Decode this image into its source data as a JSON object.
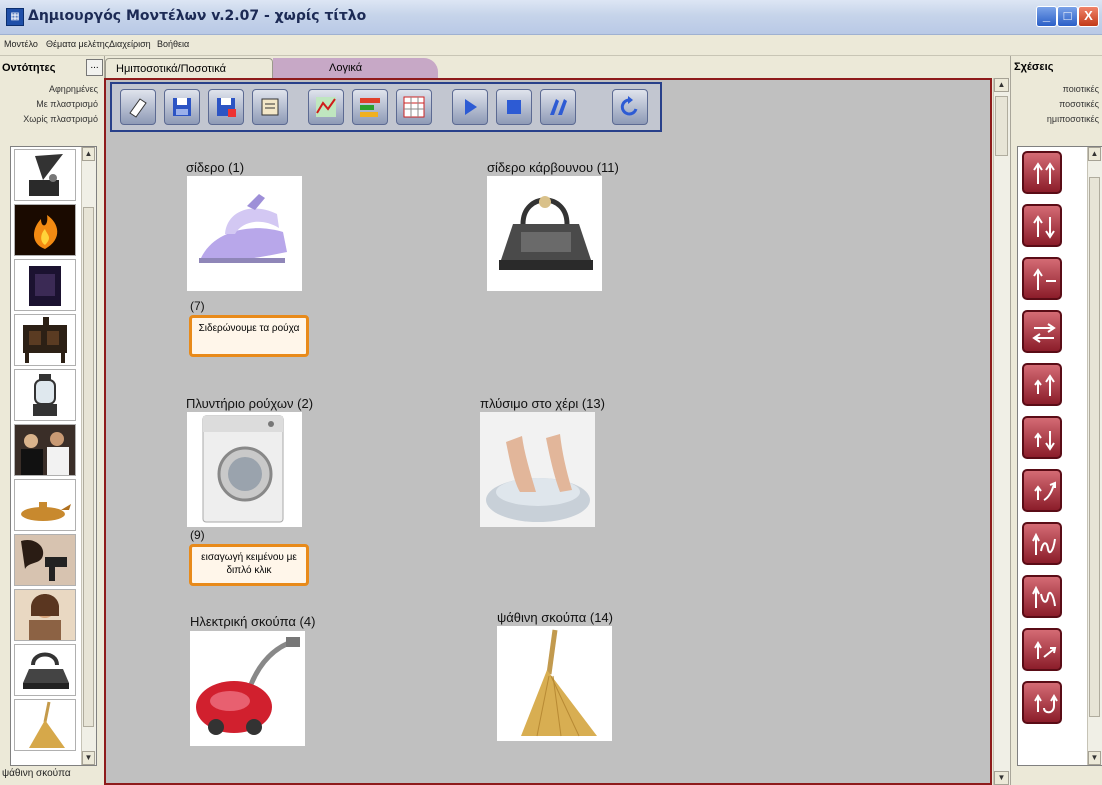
{
  "window": {
    "title": "Δημιουργός Μοντέλων v.2.07 - χωρίς τίτλο",
    "min_label": "_",
    "max_label": "□",
    "close_label": "X"
  },
  "menu": [
    "Μοντέλο",
    "Θέματα μελέτης",
    "Διαχείριση",
    "Βοήθεια"
  ],
  "left_panel": {
    "header": "Οντότητες",
    "more_button": "...",
    "categories": [
      "Αφηρημένες",
      "Με πλαστρισμό",
      "Χωρίς πλαστρισμό"
    ],
    "thumbnails": [
      "gramophone-thumbnail",
      "fire-thumbnail",
      "dark-object-thumbnail",
      "stove-thumbnail",
      "lantern-thumbnail",
      "people-thumbnail",
      "oil-lamp-thumbnail",
      "hairdryer-thumbnail",
      "woman-thumbnail",
      "coal-iron-thumbnail",
      "broom-thumbnail"
    ],
    "status": "ψάθινη σκούπα"
  },
  "tabs": [
    "Ημιποσοτικά/Ποσοτικά",
    "Λογικά"
  ],
  "toolbar": {
    "buttons": [
      "new-icon",
      "save-icon",
      "save-as-icon",
      "print-icon",
      "graph-icon",
      "bars-icon",
      "table-icon",
      "play-icon",
      "stop-icon",
      "step-icon",
      "undo-icon"
    ]
  },
  "canvas": {
    "entities": [
      {
        "name": "σίδερο (1)",
        "image": "electric-iron"
      },
      {
        "name": "σίδερο κάρβουνου (11)",
        "image": "coal-iron"
      },
      {
        "name": "Πλυντήριο ρούχων (2)",
        "image": "washing-machine"
      },
      {
        "name": "πλύσιμο στο χέρι (13)",
        "image": "hand-washing"
      },
      {
        "name": "Ηλεκτρική σκούπα (4)",
        "image": "vacuum-cleaner"
      },
      {
        "name": "ψάθινη σκούπα (14)",
        "image": "straw-broom"
      }
    ],
    "functions": [
      {
        "number": "(7)",
        "text": "Σιδερώνουμε τα ρούχα"
      },
      {
        "number": "(9)",
        "text": "εισαγωγή κειμένου με διπλό κλικ"
      }
    ]
  },
  "right_panel": {
    "header": "Σχέσεις",
    "categories": [
      "ποιοτικές",
      "ποσοτικές",
      "ημιποσοτικές"
    ],
    "relations": [
      "up-up-icon",
      "up-down-icon",
      "up-minus-icon",
      "swap-arrows-icon",
      "inc-inc-icon",
      "inc-dec-icon",
      "inc-curve-icon",
      "wave-up-icon",
      "wave-down-icon",
      "inc-ramp-icon",
      "inc-loop-icon"
    ]
  },
  "colors": {
    "titlebar": "#c6d4ea",
    "canvas_bg": "#c0c0c0",
    "canvas_border": "#8e1b1b",
    "function_border": "#e88a1a",
    "relation_button": "#a83240",
    "tab_inactive": "#c7a8c6"
  }
}
